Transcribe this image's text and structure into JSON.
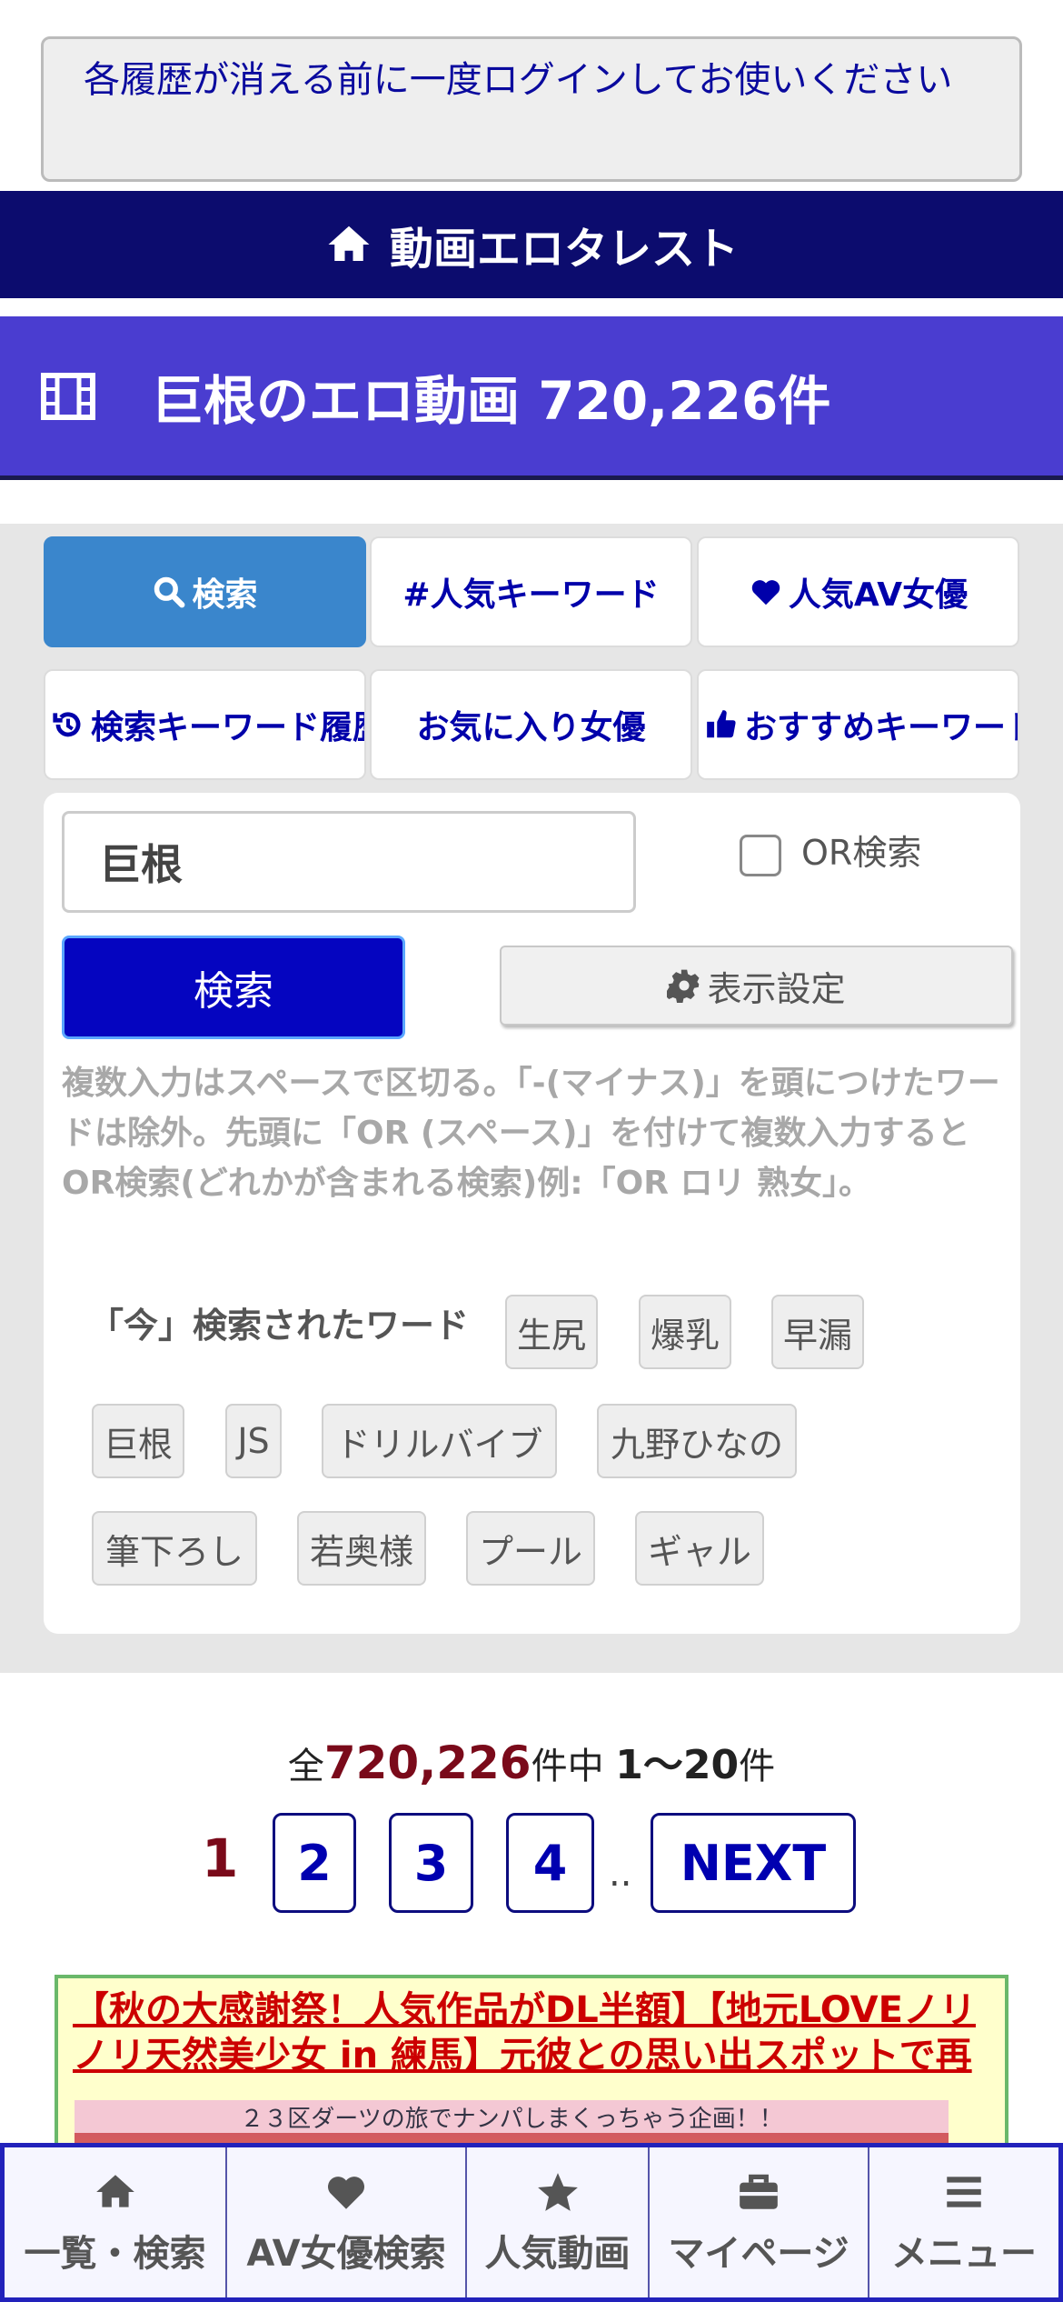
{
  "notice": {
    "text": "各履歴が消える前に一度ログインしてお使いください"
  },
  "site": {
    "title": "動画エロタレスト"
  },
  "page": {
    "heading": "巨根のエロ動画 720,226件"
  },
  "tabs": [
    {
      "label": "検索",
      "icon": "search-icon",
      "active": true
    },
    {
      "label": "#人気キーワード",
      "icon": "",
      "active": false
    },
    {
      "label": "人気AV女優",
      "icon": "heart-icon",
      "active": false
    },
    {
      "label": "検索キーワード履歴",
      "icon": "history-icon",
      "active": false
    },
    {
      "label": "お気に入り女優",
      "icon": "",
      "active": false
    },
    {
      "label": "おすすめキーワード",
      "icon": "thumbs-up-icon",
      "active": false
    }
  ],
  "search": {
    "value": "巨根",
    "or_label": "OR検索",
    "or_checked": false,
    "button": "検索",
    "display_settings": "表示設定",
    "help": "複数入力はスペースで区切る。「-(マイナス)」を頭につけたワードは除外。先頭に「OR (スペース)」を付けて複数入力するとOR検索(どれかが含まれる検索)例:「OR ロリ 熟女」。"
  },
  "recent": {
    "label": "「今」検索されたワード",
    "words": [
      "生尻",
      "爆乳",
      "早漏",
      "巨根",
      "JS",
      "ドリルバイブ",
      "九野ひなの",
      "筆下ろし",
      "若奥様",
      "プール",
      "ギャル"
    ]
  },
  "results": {
    "prefix": "全",
    "total": "720,226",
    "middle": "件中",
    "range": "1〜20",
    "suffix": "件"
  },
  "pager": {
    "current": "1",
    "pages": [
      "2",
      "3",
      "4"
    ],
    "dots": "..",
    "next": "NEXT"
  },
  "ad": {
    "text": "【秋の大感謝祭！人気作品がDL半額】【地元LOVEノリノリ天然美少女 in 練馬】元彼との思い出スポットで再",
    "image_caption": "２３区ダーツの旅でナンパしまくっちゃう企画！！"
  },
  "bottom_nav": [
    {
      "label": "一覧・検索",
      "icon": "home-icon"
    },
    {
      "label": "AV女優検索",
      "icon": "heart-icon"
    },
    {
      "label": "人気動画",
      "icon": "star-icon"
    },
    {
      "label": "マイページ",
      "icon": "briefcase-icon"
    },
    {
      "label": "メニュー",
      "icon": "menu-icon"
    }
  ],
  "colors": {
    "site_bar": "#0c0c6e",
    "page_head": "#4a3dd0",
    "active_tab": "#3a86cc",
    "search_button": "#0505c0",
    "count_accent": "#7a0a1a",
    "ad_text": "#cc0000"
  }
}
